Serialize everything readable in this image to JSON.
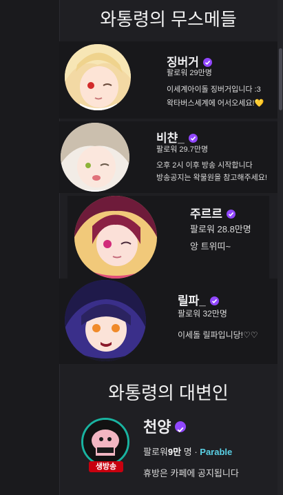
{
  "section_titles": {
    "members": "와통령의 무스메들",
    "spokesperson": "와통령의 대변인"
  },
  "members": [
    {
      "name": "징버거",
      "followers": "팔로워 29만명",
      "desc1": "이세계아이돌 징버거입니다 :3",
      "desc2": "왁타버스세계에 어서오세요!💛",
      "verified_icon": "verified-check-icon"
    },
    {
      "name": "비챤_",
      "followers": "팔로워 29.7만명",
      "desc1": "오후 2시 이후 방송 시작합니다",
      "desc2": "방송공지는 왁물원을 참고해주세요!",
      "verified_icon": "verified-check-icon"
    },
    {
      "name": "주르르",
      "followers": "팔로워 28.8만명",
      "desc1": "앙 트위띠~",
      "verified_icon": "verified-check-icon"
    },
    {
      "name": "릴파_",
      "followers": "팔로워 32만명",
      "desc1": "이세돌 릴파입니당!♡♡",
      "verified_icon": "verified-check-icon"
    }
  ],
  "spokesperson": {
    "name": "천양",
    "followers_prefix": "팔로워",
    "followers_count": "9만",
    "followers_suffix": "명",
    "separator": "·",
    "team": "Parable",
    "desc": "휴방은 카페에 공지됩니다",
    "live_badge": "생방송"
  },
  "colors": {
    "verified": "#9147ff",
    "live": "#c8000f",
    "team": "#5ad1e6",
    "background": "#1f1f23"
  }
}
